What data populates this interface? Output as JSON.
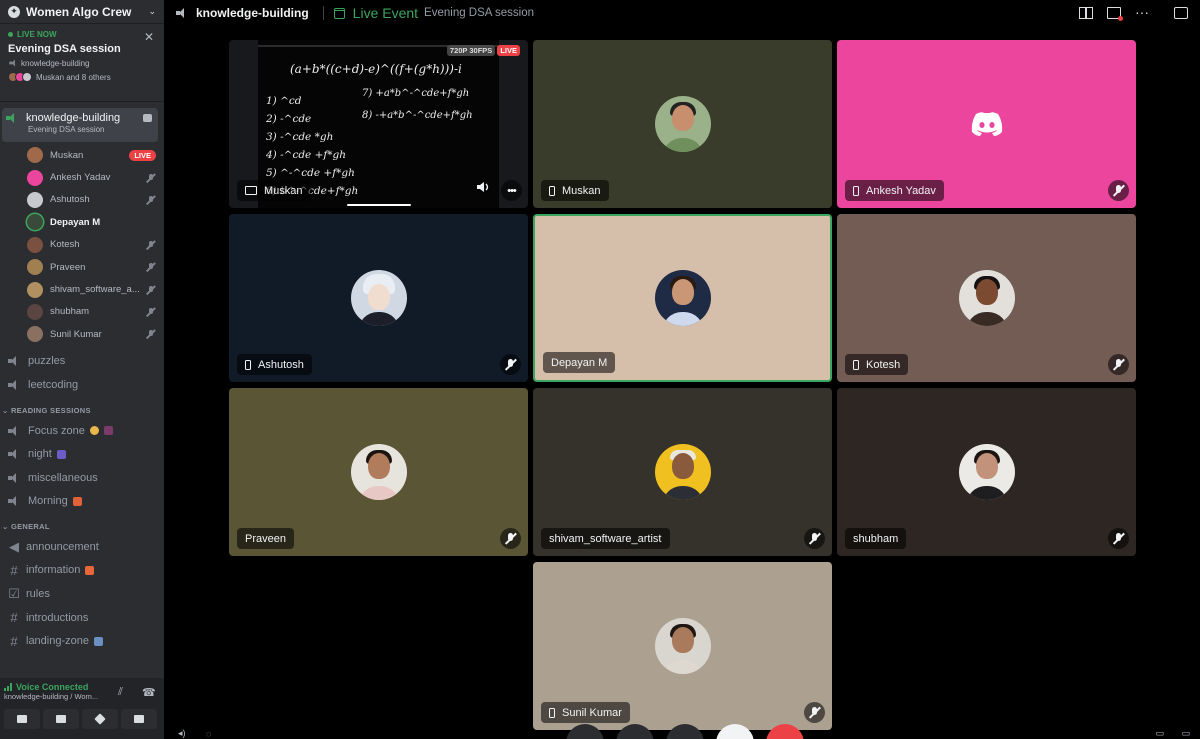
{
  "server": {
    "name": "Women Algo Crew"
  },
  "live_card": {
    "label": "LIVE NOW",
    "title": "Evening DSA session",
    "channel": "knowledge-building",
    "people": "Muskan and 8 others"
  },
  "active_channel": {
    "name": "knowledge-building",
    "subtitle": "Evening DSA session"
  },
  "members": [
    {
      "name": "Muskan",
      "badge": "LIVE",
      "color": "#a06a4a"
    },
    {
      "name": "Ankesh Yadav",
      "color": "#eb459e"
    },
    {
      "name": "Ashutosh",
      "color": "#c7c9cf"
    },
    {
      "name": "Depayan M",
      "color": "#3a4a3a"
    },
    {
      "name": "Kotesh",
      "color": "#7a5040"
    },
    {
      "name": "Praveen",
      "color": "#a08050"
    },
    {
      "name": "shivam_software_a...",
      "color": "#b09060"
    },
    {
      "name": "shubham",
      "color": "#5a4540"
    },
    {
      "name": "Sunil Kumar",
      "color": "#8a7060"
    }
  ],
  "voice_channels": [
    {
      "name": "puzzles"
    },
    {
      "name": "leetcoding"
    }
  ],
  "reading_sessions": {
    "label": "READING SESSIONS",
    "channels": [
      {
        "name": "Focus zone",
        "emoji_color": "#e8b64a"
      },
      {
        "name": "night",
        "emoji_color": "#6b5cc7"
      },
      {
        "name": "miscellaneous"
      },
      {
        "name": "Morning",
        "emoji_color": "#e0613a"
      }
    ]
  },
  "general": {
    "label": "GENERAL",
    "channels": [
      {
        "name": "announcement",
        "icon": "megaphone-icon"
      },
      {
        "name": "information",
        "icon": "hash-icon",
        "emoji_color": "#e8663a"
      },
      {
        "name": "rules",
        "icon": "checkbox-icon"
      },
      {
        "name": "introductions",
        "icon": "hash-icon"
      },
      {
        "name": "landing-zone",
        "icon": "hash-icon",
        "emoji_color": "#6a8fc0"
      }
    ]
  },
  "voice_panel": {
    "status": "Voice Connected",
    "location": "knowledge-building / Wom..."
  },
  "topbar": {
    "channel": "knowledge-building",
    "event_label": "Live Event",
    "event_name": "Evening DSA session"
  },
  "stream": {
    "resolution": "720P 30FPS",
    "live": "LIVE",
    "name": "Muskan"
  },
  "tiles": [
    {
      "name": "Muskan",
      "bg": "#393c2a",
      "device": "phone"
    },
    {
      "name": "Ankesh Yadav",
      "bg": "#eb459e",
      "device": "phone",
      "muted": true
    },
    {
      "name": "Ashutosh",
      "bg": "#111b28",
      "device": "phone",
      "muted": true
    },
    {
      "name": "Depayan M",
      "bg": "#d6bfaa",
      "device": "none",
      "selected": true
    },
    {
      "name": "Kotesh",
      "bg": "#735c54",
      "device": "phone",
      "muted": true
    },
    {
      "name": "Praveen",
      "bg": "#5a5535",
      "device": "none",
      "muted": true
    },
    {
      "name": "shivam_software_artist",
      "bg": "#34322a",
      "device": "none",
      "muted": true
    },
    {
      "name": "shubham",
      "bg": "#2e2622",
      "device": "none",
      "muted": true
    },
    {
      "name": "Sunil Kumar",
      "bg": "#aca190",
      "device": "phone",
      "muted": true
    }
  ],
  "whiteboard_lines": [
    "(a+b*((c+d)-e)^((f+(g*h)))-i",
    "1) ^cd",
    "2) -^cde",
    "3) -^cde *gh",
    "4) -^cde +f*gh",
    "5) ^-^cde +f*gh",
    "6) b^-^cde+f*gh",
    "7) +a*b^-^cde+f*gh",
    "8) -+a*b^-^cde+f*gh"
  ]
}
